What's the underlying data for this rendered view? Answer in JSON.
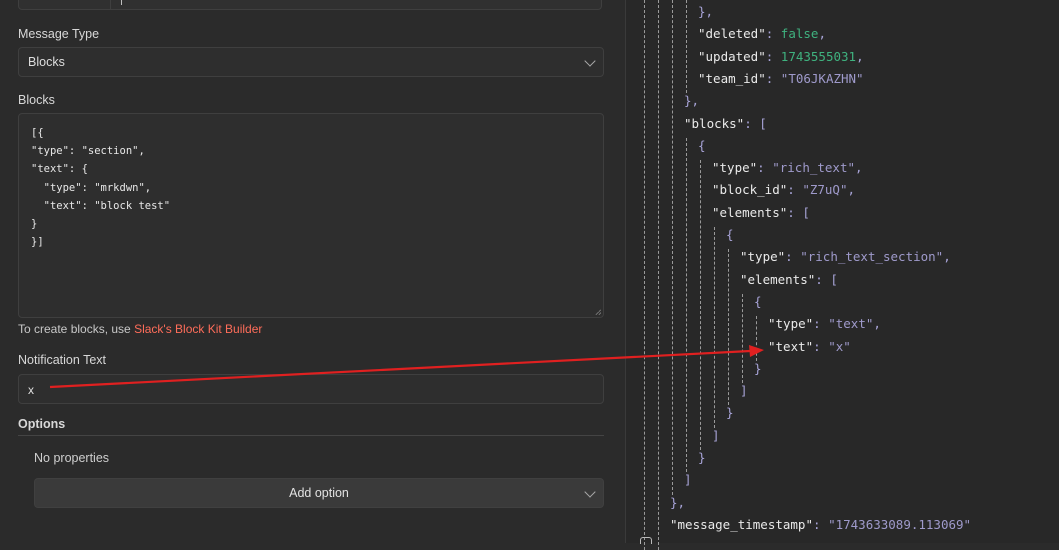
{
  "form": {
    "message_type_label": "Message Type",
    "message_type_value": "Blocks",
    "blocks_label": "Blocks",
    "blocks_value": "[{\n\"type\": \"section\",\n\"text\": {\n  \"type\": \"mrkdwn\",\n  \"text\": \"block test\"\n}\n}]",
    "hint_prefix": "To create blocks, use ",
    "hint_link": "Slack's Block Kit Builder",
    "notification_label": "Notification Text",
    "notification_value": "x",
    "options_label": "Options",
    "no_properties": "No properties",
    "add_option_label": "Add option"
  },
  "json_view": {
    "lines": [
      {
        "indent": 4,
        "parts": [
          {
            "t": "},",
            "c": "p"
          }
        ]
      },
      {
        "indent": 4,
        "parts": [
          {
            "t": "\"deleted\"",
            "c": "k"
          },
          {
            "t": ": ",
            "c": "p"
          },
          {
            "t": "false",
            "c": "b"
          },
          {
            "t": ",",
            "c": "p"
          }
        ]
      },
      {
        "indent": 4,
        "parts": [
          {
            "t": "\"updated\"",
            "c": "k"
          },
          {
            "t": ": ",
            "c": "p"
          },
          {
            "t": "1743555031",
            "c": "n"
          },
          {
            "t": ",",
            "c": "p"
          }
        ]
      },
      {
        "indent": 4,
        "parts": [
          {
            "t": "\"team_id\"",
            "c": "k"
          },
          {
            "t": ": ",
            "c": "p"
          },
          {
            "t": "\"T06JKAZHN\"",
            "c": "s"
          }
        ]
      },
      {
        "indent": 3,
        "parts": [
          {
            "t": "},",
            "c": "p"
          }
        ]
      },
      {
        "indent": 3,
        "parts": [
          {
            "t": "\"blocks\"",
            "c": "k"
          },
          {
            "t": ": [",
            "c": "p"
          }
        ]
      },
      {
        "indent": 4,
        "parts": [
          {
            "t": "{",
            "c": "p"
          }
        ]
      },
      {
        "indent": 5,
        "parts": [
          {
            "t": "\"type\"",
            "c": "k"
          },
          {
            "t": ": ",
            "c": "p"
          },
          {
            "t": "\"rich_text\"",
            "c": "s"
          },
          {
            "t": ",",
            "c": "p"
          }
        ]
      },
      {
        "indent": 5,
        "parts": [
          {
            "t": "\"block_id\"",
            "c": "k"
          },
          {
            "t": ": ",
            "c": "p"
          },
          {
            "t": "\"Z7uQ\"",
            "c": "s"
          },
          {
            "t": ",",
            "c": "p"
          }
        ]
      },
      {
        "indent": 5,
        "parts": [
          {
            "t": "\"elements\"",
            "c": "k"
          },
          {
            "t": ": [",
            "c": "p"
          }
        ]
      },
      {
        "indent": 6,
        "parts": [
          {
            "t": "{",
            "c": "p"
          }
        ]
      },
      {
        "indent": 7,
        "parts": [
          {
            "t": "\"type\"",
            "c": "k"
          },
          {
            "t": ": ",
            "c": "p"
          },
          {
            "t": "\"rich_text_section\"",
            "c": "s"
          },
          {
            "t": ",",
            "c": "p"
          }
        ]
      },
      {
        "indent": 7,
        "parts": [
          {
            "t": "\"elements\"",
            "c": "k"
          },
          {
            "t": ": [",
            "c": "p"
          }
        ]
      },
      {
        "indent": 8,
        "parts": [
          {
            "t": "{",
            "c": "p"
          }
        ]
      },
      {
        "indent": 9,
        "parts": [
          {
            "t": "\"type\"",
            "c": "k"
          },
          {
            "t": ": ",
            "c": "p"
          },
          {
            "t": "\"text\"",
            "c": "s"
          },
          {
            "t": ",",
            "c": "p"
          }
        ]
      },
      {
        "indent": 9,
        "parts": [
          {
            "t": "\"text\"",
            "c": "k"
          },
          {
            "t": ": ",
            "c": "p"
          },
          {
            "t": "\"x\"",
            "c": "s"
          }
        ]
      },
      {
        "indent": 8,
        "parts": [
          {
            "t": "}",
            "c": "p"
          }
        ]
      },
      {
        "indent": 7,
        "parts": [
          {
            "t": "]",
            "c": "p"
          }
        ]
      },
      {
        "indent": 6,
        "parts": [
          {
            "t": "}",
            "c": "p"
          }
        ]
      },
      {
        "indent": 5,
        "parts": [
          {
            "t": "]",
            "c": "p"
          }
        ]
      },
      {
        "indent": 4,
        "parts": [
          {
            "t": "}",
            "c": "p"
          }
        ]
      },
      {
        "indent": 3,
        "parts": [
          {
            "t": "]",
            "c": "p"
          }
        ]
      },
      {
        "indent": 2,
        "parts": [
          {
            "t": "},",
            "c": "p"
          }
        ]
      },
      {
        "indent": 2,
        "parts": [
          {
            "t": "\"message_timestamp\"",
            "c": "k"
          },
          {
            "t": ": ",
            "c": "p"
          },
          {
            "t": "\"1743633089.113069\"",
            "c": "s"
          }
        ]
      }
    ]
  },
  "colors": {
    "accent_link": "#ff6d5a",
    "annotation_arrow": "#e02020"
  }
}
